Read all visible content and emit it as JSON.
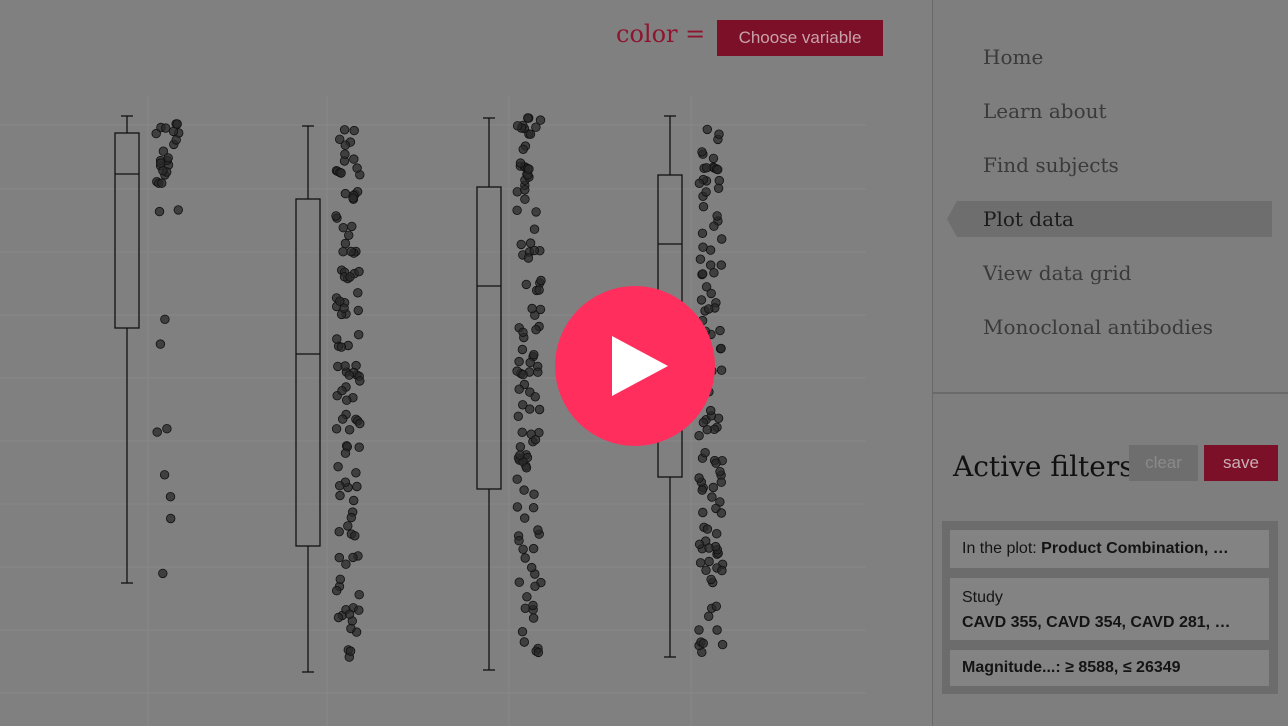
{
  "colors": {
    "accent": "#7c1028",
    "play": "#ff2e5d",
    "active_nav": "#6e6e6e"
  },
  "plot": {
    "color_label": "color =",
    "choose_button": "Choose variable",
    "groups": [
      {
        "whisker_low": 583,
        "q1": 328,
        "median": 174,
        "q3": 133,
        "whisker_high": 116
      },
      {
        "whisker_low": 672,
        "q1": 546,
        "median": 354,
        "q3": 199,
        "whisker_high": 126
      },
      {
        "whisker_low": 670,
        "q1": 489,
        "median": 286,
        "q3": 187,
        "whisker_high": 118
      },
      {
        "whisker_low": 657,
        "q1": 477,
        "median": 244,
        "q3": 175,
        "whisker_high": 116
      }
    ]
  },
  "nav": {
    "items": [
      {
        "label": "Home"
      },
      {
        "label": "Learn about"
      },
      {
        "label": "Find subjects"
      },
      {
        "label": "Plot data",
        "active": true
      },
      {
        "label": "View data grid"
      },
      {
        "label": "Monoclonal antibodies"
      }
    ]
  },
  "filters": {
    "title": "Active filters",
    "clear_label": "clear",
    "save_label": "save",
    "in_plot_prefix": "In the plot:",
    "in_plot_value": "Product Combination, …",
    "study_label": "Study",
    "study_value": "CAVD 355, CAVD 354, CAVD 281, …",
    "magnitude": "Magnitude...: ≥ 8588, ≤ 26349"
  },
  "overlay": {
    "play_icon": "play-icon"
  }
}
